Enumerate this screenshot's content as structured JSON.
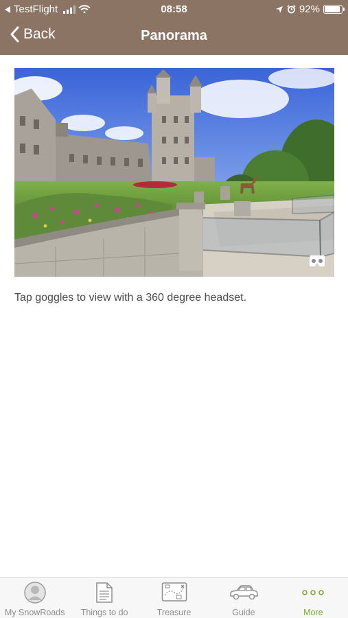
{
  "status_bar": {
    "carrier": "TestFlight",
    "time": "08:58",
    "battery_percent": "92%",
    "battery_level": 0.92,
    "icons": [
      "back-triangle-icon",
      "signal-icon",
      "wifi-icon",
      "location-arrow-icon",
      "alarm-icon",
      "battery-icon"
    ]
  },
  "nav": {
    "back_label": "Back",
    "title": "Panorama"
  },
  "content": {
    "image": "castle-panorama-image",
    "goggles_icon": "vr-goggles-icon",
    "caption": "Tap goggles to view with a 360 degree headset."
  },
  "tab_bar": {
    "items": [
      {
        "label": "My SnowRoads",
        "icon": "person-avatar-icon",
        "active": false
      },
      {
        "label": "Things to do",
        "icon": "document-icon",
        "active": false
      },
      {
        "label": "Treasure",
        "icon": "treasure-map-icon",
        "active": false
      },
      {
        "label": "Guide",
        "icon": "car-icon",
        "active": false
      },
      {
        "label": "More",
        "icon": "more-dots-icon",
        "active": true
      }
    ],
    "active_color": "#7aab2c",
    "inactive_color": "#8e8e8e"
  },
  "colors": {
    "header_bg": "#8c7464",
    "tab_bar_bg": "#f7f7f7"
  }
}
